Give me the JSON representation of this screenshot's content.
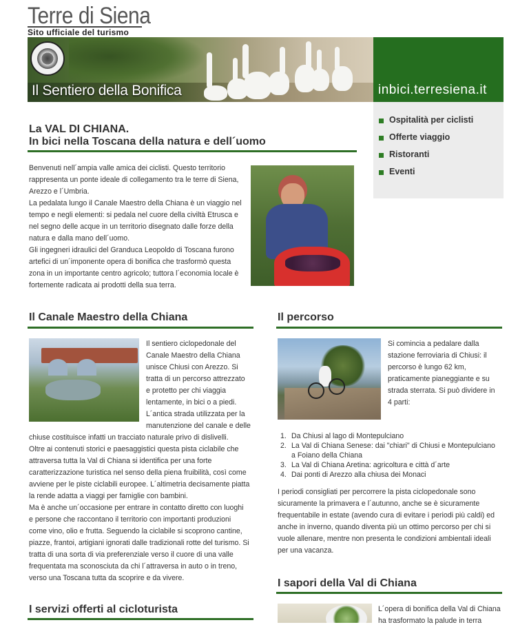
{
  "header": {
    "logo_title": "Terre di Siena",
    "logo_subtitle": "Sito ufficiale del turismo",
    "banner_title": "Il Sentiero della Bonifica",
    "site_url": "inbici.terresiena.it"
  },
  "menu": {
    "items": [
      "Ospitalità per ciclisti",
      "Offerte viaggio",
      "Ristoranti",
      "Eventi"
    ]
  },
  "intro": {
    "title_line1": "La VAL DI CHIANA.",
    "title_line2": "In bici nella Toscana della natura e dell´uomo",
    "lines": [
      "Benvenuti nell´ampia valle amica dei ciclisti. Questo territorio",
      "rappresenta un ponte ideale di collegamento tra le terre di Siena,",
      "Arezzo e l´Umbria.",
      "La pedalata lungo il Canale Maestro della Chiana è un viaggio nel",
      "tempo e negli elementi: si pedala nel cuore della civiltà Etrusca e",
      "nel segno delle acque in un territorio disegnato dalle forze della",
      "natura e dalla mano dell´uomo.",
      "Gli ingegneri idraulici del Granduca Leopoldo di Toscana furono",
      "artefici di un´imponente opera di bonifica che trasformò questa",
      "zona in un importante centro agricolo; tuttora l´economia locale è",
      "fortemente radicata ai prodotti della sua terra."
    ]
  },
  "canale": {
    "title": "Il Canale Maestro della Chiana",
    "side_lines": [
      "Il sentiero ciclopedonale del",
      "Canale Maestro della Chiana",
      "unisce Chiusi con Arezzo. Si",
      "tratta di un percorso attrezzato",
      "e protetto per chi viaggia",
      "lentamente, in bici o a piedi.",
      "L´antica strada utilizzata per la",
      "manutenzione del canale e delle"
    ],
    "full_lines": [
      "chiuse costituisce infatti un tracciato naturale privo di dislivelli.",
      "Oltre ai contenuti storici e paesaggistici questa pista ciclabile che",
      "attraversa tutta la Val di Chiana si identifica per una forte",
      "caratterizzazione turistica nel senso della piena fruibilità, così come",
      "avviene per le piste ciclabili europee. L´altimetria decisamente piatta",
      "la rende adatta a viaggi per famiglie con bambini.",
      "Ma è anche un´occasione per entrare in contatto diretto con luoghi",
      "e persone che raccontano il territorio con importanti produzioni",
      "come vino, olio e frutta. Seguendo la ciclabile si scoprono cantine,",
      "piazze, frantoi, artigiani ignorati dalle tradizionali rotte del turismo. Si",
      "tratta di una sorta di via preferenziale verso il cuore di una valle",
      "frequentata ma sconosciuta da chi l´attraversa in auto o in treno,",
      "verso una Toscana tutta da scoprire e da vivere."
    ]
  },
  "servizi": {
    "title": "I servizi offerti al cicloturista"
  },
  "percorso": {
    "title": "Il percorso",
    "side_lines": [
      "Si comincia a pedalare dalla",
      "stazione ferroviaria di Chiusi: il",
      "percorso è lungo 62 km,",
      "praticamente pianeggiante e su",
      "strada sterrata. Si può dividere in",
      "4 parti:"
    ],
    "list": [
      {
        "num": "1.",
        "lines": [
          "Da Chiusi al lago di Montepulciano"
        ]
      },
      {
        "num": "2.",
        "lines": [
          "La Val di Chiana Senese: dai \"chiari\" di Chiusi e Montepulciano",
          "a Foiano della Chiana"
        ]
      },
      {
        "num": "3.",
        "lines": [
          "La Val di Chiana Aretina: agricoltura e città d´arte"
        ]
      },
      {
        "num": "4.",
        "lines": [
          "Dai ponti di Arezzo alla chiusa dei Monaci"
        ]
      }
    ],
    "after_lines": [
      "I periodi consigliati per percorrere la pista ciclopedonale sono",
      "sicuramente la primavera e l´autunno, anche se è sicuramente",
      "frequentabile in estate (avendo cura di evitare i periodi più caldi) ed",
      "anche in inverno, quando diventa più un ottimo percorso per chi si",
      "vuole allenare, mentre non presenta le condizioni ambientali ideali",
      "per una vacanza."
    ]
  },
  "sapori": {
    "title": "I sapori della Val di Chiana",
    "side_lines": [
      "L´opera di bonifica della Val di Chiana",
      "ha trasformato la palude in terra"
    ]
  },
  "colors": {
    "accent_green": "#2d6e25",
    "box_green": "#256e1f",
    "menu_bg": "#ececec"
  }
}
